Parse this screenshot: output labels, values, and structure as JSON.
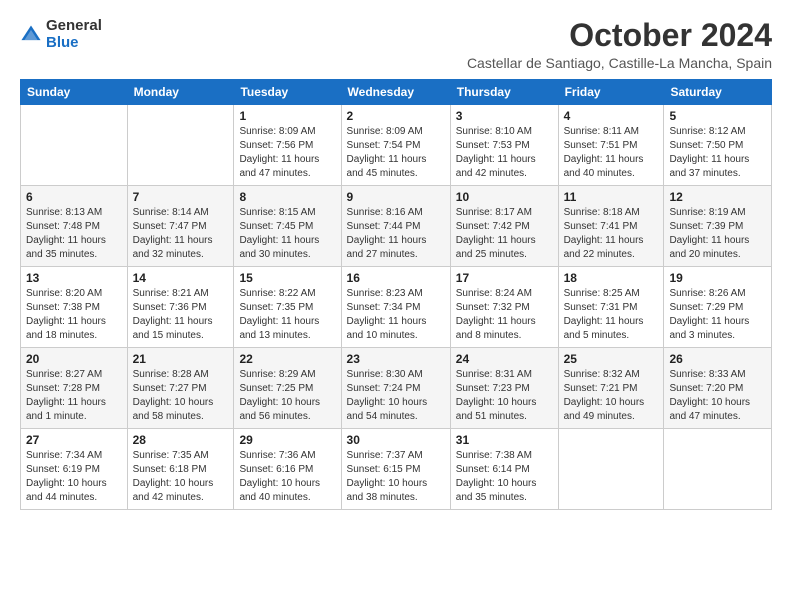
{
  "logo": {
    "general": "General",
    "blue": "Blue"
  },
  "title": "October 2024",
  "location": "Castellar de Santiago, Castille-La Mancha, Spain",
  "days_of_week": [
    "Sunday",
    "Monday",
    "Tuesday",
    "Wednesday",
    "Thursday",
    "Friday",
    "Saturday"
  ],
  "weeks": [
    [
      {
        "day": "",
        "info": ""
      },
      {
        "day": "",
        "info": ""
      },
      {
        "day": "1",
        "info": "Sunrise: 8:09 AM\nSunset: 7:56 PM\nDaylight: 11 hours and 47 minutes."
      },
      {
        "day": "2",
        "info": "Sunrise: 8:09 AM\nSunset: 7:54 PM\nDaylight: 11 hours and 45 minutes."
      },
      {
        "day": "3",
        "info": "Sunrise: 8:10 AM\nSunset: 7:53 PM\nDaylight: 11 hours and 42 minutes."
      },
      {
        "day": "4",
        "info": "Sunrise: 8:11 AM\nSunset: 7:51 PM\nDaylight: 11 hours and 40 minutes."
      },
      {
        "day": "5",
        "info": "Sunrise: 8:12 AM\nSunset: 7:50 PM\nDaylight: 11 hours and 37 minutes."
      }
    ],
    [
      {
        "day": "6",
        "info": "Sunrise: 8:13 AM\nSunset: 7:48 PM\nDaylight: 11 hours and 35 minutes."
      },
      {
        "day": "7",
        "info": "Sunrise: 8:14 AM\nSunset: 7:47 PM\nDaylight: 11 hours and 32 minutes."
      },
      {
        "day": "8",
        "info": "Sunrise: 8:15 AM\nSunset: 7:45 PM\nDaylight: 11 hours and 30 minutes."
      },
      {
        "day": "9",
        "info": "Sunrise: 8:16 AM\nSunset: 7:44 PM\nDaylight: 11 hours and 27 minutes."
      },
      {
        "day": "10",
        "info": "Sunrise: 8:17 AM\nSunset: 7:42 PM\nDaylight: 11 hours and 25 minutes."
      },
      {
        "day": "11",
        "info": "Sunrise: 8:18 AM\nSunset: 7:41 PM\nDaylight: 11 hours and 22 minutes."
      },
      {
        "day": "12",
        "info": "Sunrise: 8:19 AM\nSunset: 7:39 PM\nDaylight: 11 hours and 20 minutes."
      }
    ],
    [
      {
        "day": "13",
        "info": "Sunrise: 8:20 AM\nSunset: 7:38 PM\nDaylight: 11 hours and 18 minutes."
      },
      {
        "day": "14",
        "info": "Sunrise: 8:21 AM\nSunset: 7:36 PM\nDaylight: 11 hours and 15 minutes."
      },
      {
        "day": "15",
        "info": "Sunrise: 8:22 AM\nSunset: 7:35 PM\nDaylight: 11 hours and 13 minutes."
      },
      {
        "day": "16",
        "info": "Sunrise: 8:23 AM\nSunset: 7:34 PM\nDaylight: 11 hours and 10 minutes."
      },
      {
        "day": "17",
        "info": "Sunrise: 8:24 AM\nSunset: 7:32 PM\nDaylight: 11 hours and 8 minutes."
      },
      {
        "day": "18",
        "info": "Sunrise: 8:25 AM\nSunset: 7:31 PM\nDaylight: 11 hours and 5 minutes."
      },
      {
        "day": "19",
        "info": "Sunrise: 8:26 AM\nSunset: 7:29 PM\nDaylight: 11 hours and 3 minutes."
      }
    ],
    [
      {
        "day": "20",
        "info": "Sunrise: 8:27 AM\nSunset: 7:28 PM\nDaylight: 11 hours and 1 minute."
      },
      {
        "day": "21",
        "info": "Sunrise: 8:28 AM\nSunset: 7:27 PM\nDaylight: 10 hours and 58 minutes."
      },
      {
        "day": "22",
        "info": "Sunrise: 8:29 AM\nSunset: 7:25 PM\nDaylight: 10 hours and 56 minutes."
      },
      {
        "day": "23",
        "info": "Sunrise: 8:30 AM\nSunset: 7:24 PM\nDaylight: 10 hours and 54 minutes."
      },
      {
        "day": "24",
        "info": "Sunrise: 8:31 AM\nSunset: 7:23 PM\nDaylight: 10 hours and 51 minutes."
      },
      {
        "day": "25",
        "info": "Sunrise: 8:32 AM\nSunset: 7:21 PM\nDaylight: 10 hours and 49 minutes."
      },
      {
        "day": "26",
        "info": "Sunrise: 8:33 AM\nSunset: 7:20 PM\nDaylight: 10 hours and 47 minutes."
      }
    ],
    [
      {
        "day": "27",
        "info": "Sunrise: 7:34 AM\nSunset: 6:19 PM\nDaylight: 10 hours and 44 minutes."
      },
      {
        "day": "28",
        "info": "Sunrise: 7:35 AM\nSunset: 6:18 PM\nDaylight: 10 hours and 42 minutes."
      },
      {
        "day": "29",
        "info": "Sunrise: 7:36 AM\nSunset: 6:16 PM\nDaylight: 10 hours and 40 minutes."
      },
      {
        "day": "30",
        "info": "Sunrise: 7:37 AM\nSunset: 6:15 PM\nDaylight: 10 hours and 38 minutes."
      },
      {
        "day": "31",
        "info": "Sunrise: 7:38 AM\nSunset: 6:14 PM\nDaylight: 10 hours and 35 minutes."
      },
      {
        "day": "",
        "info": ""
      },
      {
        "day": "",
        "info": ""
      }
    ]
  ]
}
